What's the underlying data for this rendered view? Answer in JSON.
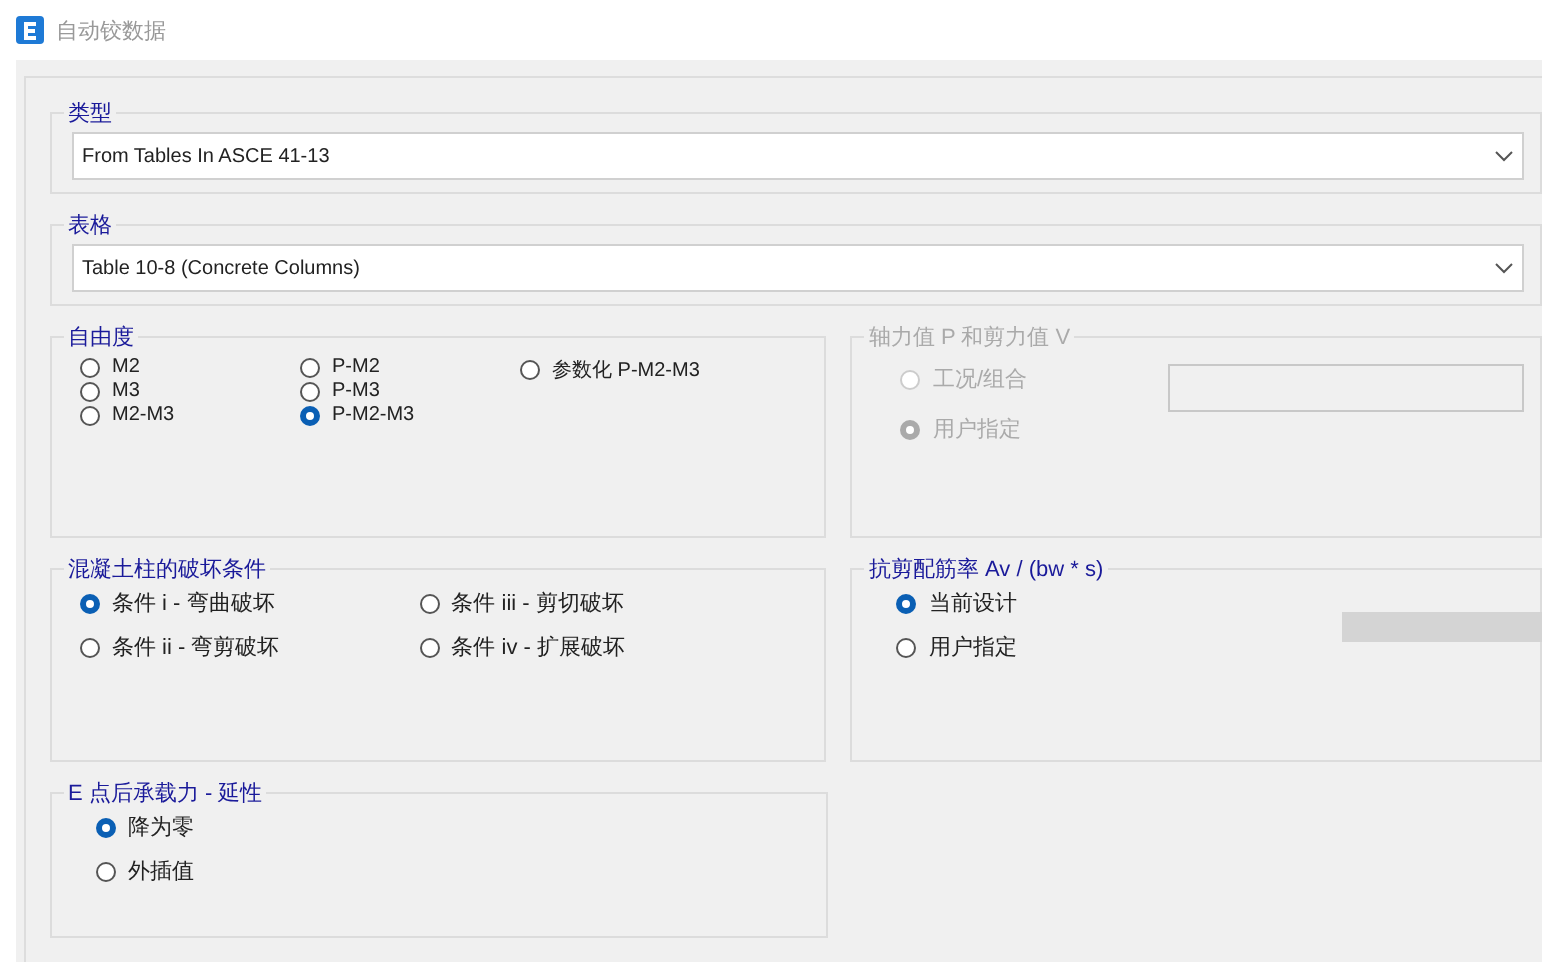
{
  "window": {
    "title": "自动铰数据"
  },
  "type_group": {
    "title": "类型",
    "value": "From Tables In ASCE 41-13"
  },
  "table_group": {
    "title": "表格",
    "value": "Table 10-8 (Concrete Columns)"
  },
  "dof_group": {
    "title": "自由度",
    "columns": [
      [
        {
          "label": "M2",
          "selected": false
        },
        {
          "label": "M3",
          "selected": false
        },
        {
          "label": "M2-M3",
          "selected": false
        }
      ],
      [
        {
          "label": "P-M2",
          "selected": false
        },
        {
          "label": "P-M3",
          "selected": false
        },
        {
          "label": "P-M2-M3",
          "selected": true
        }
      ],
      [
        {
          "label": "参数化 P-M2-M3",
          "selected": false
        }
      ]
    ]
  },
  "axial_group": {
    "title": "轴力值 P 和剪力值 V",
    "disabled": true,
    "options": [
      {
        "label": "工况/组合",
        "selected": false
      },
      {
        "label": "用户指定",
        "selected": true
      }
    ]
  },
  "failure_group": {
    "title": "混凝土柱的破坏条件",
    "columns": [
      [
        {
          "label": "条件 i - 弯曲破坏",
          "selected": true
        },
        {
          "label": "条件 ii - 弯剪破坏",
          "selected": false
        }
      ],
      [
        {
          "label": "条件 iii - 剪切破坏",
          "selected": false
        },
        {
          "label": "条件 iv - 扩展破坏",
          "selected": false
        }
      ]
    ]
  },
  "shear_group": {
    "title": "抗剪配筋率 Av / (bw * s)",
    "options": [
      {
        "label": "当前设计",
        "selected": true
      },
      {
        "label": "用户指定",
        "selected": false
      }
    ]
  },
  "ductility_group": {
    "title": "E 点后承载力 - 延性",
    "options": [
      {
        "label": "降为零",
        "selected": true
      },
      {
        "label": "外插值",
        "selected": false
      }
    ]
  }
}
